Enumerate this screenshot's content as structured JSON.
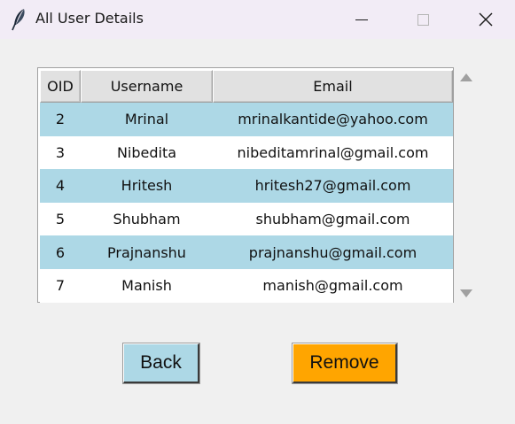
{
  "window": {
    "title": "All User Details",
    "controls": {
      "minimize": "minimize-icon",
      "maximize": "maximize-icon",
      "close": "close-icon"
    }
  },
  "table": {
    "headers": {
      "oid": "OID",
      "username": "Username",
      "email": "Email"
    },
    "rows": [
      {
        "oid": "2",
        "username": "Mrinal",
        "email": "mrinalkantide@yahoo.com"
      },
      {
        "oid": "3",
        "username": "Nibedita",
        "email": "nibeditamrinal@gmail.com"
      },
      {
        "oid": "4",
        "username": "Hritesh",
        "email": "hritesh27@gmail.com"
      },
      {
        "oid": "5",
        "username": "Shubham",
        "email": "shubham@gmail.com"
      },
      {
        "oid": "6",
        "username": "Prajnanshu",
        "email": "prajnanshu@gmail.com"
      },
      {
        "oid": "7",
        "username": "Manish",
        "email": "manish@gmail.com"
      }
    ],
    "row_colors": {
      "odd": "#add8e6",
      "even": "#ffffff"
    }
  },
  "buttons": {
    "back_label": "Back",
    "back_color": "#add8e6",
    "remove_label": "Remove",
    "remove_color": "#ffa500"
  }
}
